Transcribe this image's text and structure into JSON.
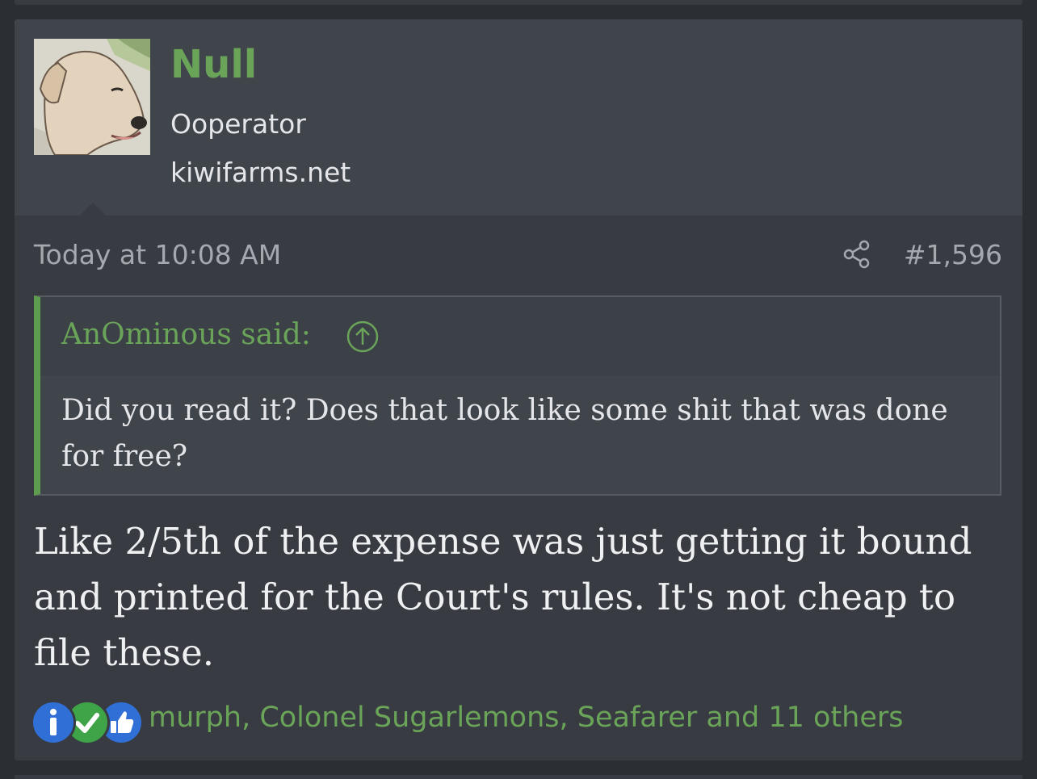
{
  "post": {
    "author": {
      "name": "Null",
      "title": "Ooperator",
      "site": "kiwifarms.net",
      "avatar_icon": "dog-avatar-icon"
    },
    "time": "Today at 10:08 AM",
    "number": "#1,596",
    "quote": {
      "author_line": "AnOminous said:",
      "text": "Did you read it? Does that look like some shit that was done for free?"
    },
    "body": "Like 2/5th of the expense was just getting it bound and printed for the Court's rules. It's not cheap to file these.",
    "reactions": {
      "icons": [
        "info-icon",
        "check-icon",
        "thumbs-up-icon"
      ],
      "users_text": "murph, Colonel Sugarlemons, Seafarer and 11 others"
    }
  },
  "colors": {
    "accent": "#6aa459",
    "page_bg": "#2b2e33",
    "post_bg": "#383b41",
    "user_block_bg": "#40444b"
  }
}
